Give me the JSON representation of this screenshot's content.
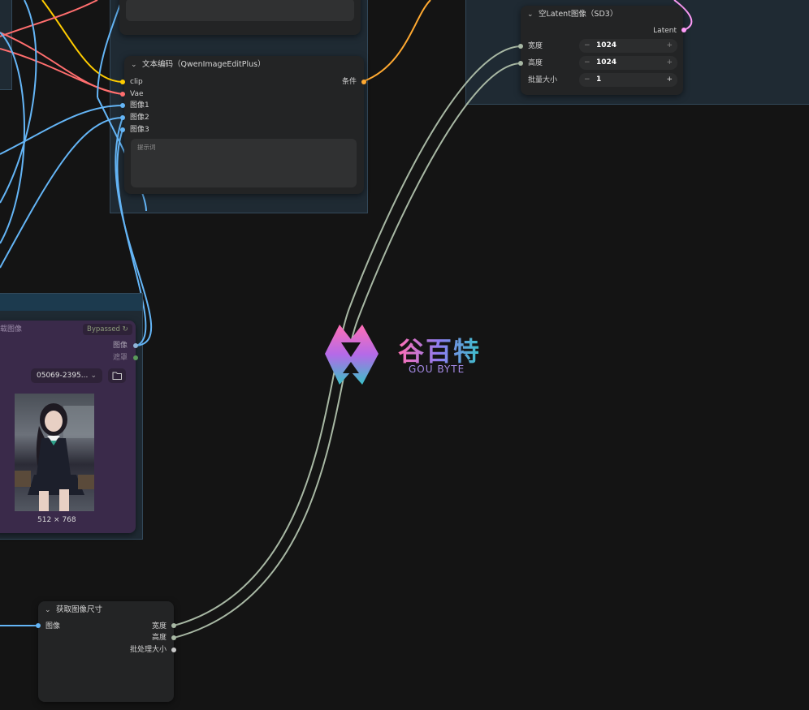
{
  "colors": {
    "canvas": "#141414",
    "group": "#1f2a33",
    "node": "#232425",
    "clip_wire": "#ffcc00",
    "vae_wire": "#ff6e6e",
    "image_wire": "#64b5f6",
    "conditioning_wire": "#ffa931",
    "latent_wire": "#ff9cf9",
    "int_wire": "#a8b8a4",
    "bypassed_node": "#3a2a4a"
  },
  "text_encode_node": {
    "title": "文本编码（QwenImageEditPlus）",
    "inputs": [
      "clip",
      "Vae",
      "图像1",
      "图像2",
      "图像3"
    ],
    "output": "条件",
    "prompt_placeholder": "提示词"
  },
  "empty_latent_node": {
    "title": "空Latent图像（SD3）",
    "output": "Latent",
    "widgets": [
      {
        "label": "宽度",
        "value": "1024"
      },
      {
        "label": "高度",
        "value": "1024"
      },
      {
        "label": "批量大小",
        "value": "1"
      }
    ]
  },
  "load_image_node": {
    "title_partial": "载图像",
    "bypassed_badge": "Bypassed",
    "outputs": [
      "图像",
      "遮罩"
    ],
    "file_name": "05069-2395...",
    "image_size": "512 × 768"
  },
  "get_size_node": {
    "title": "获取图像尺寸",
    "input": "图像",
    "outputs": [
      "宽度",
      "高度",
      "批处理大小"
    ]
  },
  "watermark": {
    "name": "谷百特",
    "subtitle": "GOU BYTE"
  }
}
